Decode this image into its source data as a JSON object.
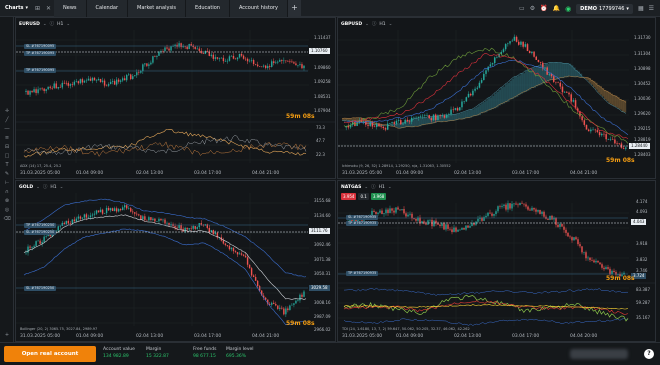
{
  "topbar": {
    "brand": "Charts",
    "tabs": [
      "News",
      "Calendar",
      "Market analysis",
      "Education",
      "Account history"
    ],
    "plus": "+",
    "account_mode": "DEMO",
    "account_id": "17799746"
  },
  "colors": {
    "up": "#26a69a",
    "down": "#ef5350",
    "accent": "#f0820a",
    "green": "#2bc46b",
    "countdown": "#f39c12"
  },
  "charts": [
    {
      "symbol": "EURUSD",
      "timeframe": "H1",
      "prices": [
        "1.11437",
        "1.10760",
        "1.09860",
        "1.09258",
        "1.08531",
        "1.07904"
      ],
      "current": "1.10760",
      "tags": [
        "SL #767190095",
        "TP #767190095",
        "TP #767190095"
      ],
      "countdown": "59m 08s",
      "ind_levels": [
        "73.3",
        "47.7",
        "22.3",
        "-3.7"
      ],
      "indicator": "ADX (14) 17, 25.4, 25.2",
      "dates": [
        "31.03.2025 05:00",
        "01.04 09:00",
        "02.04 13:00",
        "03.04 17:00",
        "04.04 21:00"
      ]
    },
    {
      "symbol": "GBPUSD",
      "timeframe": "H1",
      "prices": [
        "1.31730",
        "1.31304",
        "1.30898",
        "1.30452",
        "1.30036",
        "1.29620",
        "1.29215",
        "1.28819",
        "1.28403"
      ],
      "current": "1.28440",
      "countdown": "59m 08s",
      "indicator": "Ichimoku (9, 26, 52) 1.28914, 1.29250, n/a, 1.31063, 1.30552",
      "dates": [
        "31.03.2025 05:00",
        "01.04 09:00",
        "02.04 13:00",
        "03.04 17:00",
        "04.04 21:00"
      ]
    },
    {
      "symbol": "GOLD",
      "timeframe": "H1",
      "prices": [
        "3155.68",
        "3134.60",
        "3113.74",
        "3092.46",
        "3071.38",
        "3050.31",
        "3029.58",
        "3008.16",
        "2987.09",
        "2966.02"
      ],
      "current": "3111.76",
      "tp_price": "3029.58",
      "tags": [
        "TP #767190250",
        "SL #767190250",
        "SL #767190250"
      ],
      "countdown": "59m 08s",
      "indicator": "Bollinger (20, 2) 3065.75, 3027.84, 2989.97",
      "dates": [
        "31.03.2025 05:00",
        "01.04 09:00",
        "02.04 13:00",
        "03.04 17:00",
        "04.04 21:00"
      ]
    },
    {
      "symbol": "NATGAS",
      "timeframe": "H1",
      "trade": {
        "sell": "3.954",
        "lot": "0.1",
        "buy": "3.968"
      },
      "prices": [
        "4.174",
        "4.093",
        "3.918",
        "3.832",
        "3.746",
        "3.724"
      ],
      "current": "4.043",
      "ind_prices": [
        "83.387",
        "59.287",
        "35.167"
      ],
      "tags": [
        "SL #767190935",
        "TP #767190935",
        "TP #767190935"
      ],
      "countdown": "59m 08s",
      "indicator": "TDI (24, 1.6180, 13, 7, 2) 59.647, 50.062, 50.205, 32.37, 46.062, 42.262",
      "dates": [
        "31.03.2025 05:00",
        "01.04 09:00",
        "02.04 13:00",
        "03.04 17:00",
        "04.04 20:00"
      ]
    }
  ],
  "bottom": {
    "open_button": "Open real account",
    "account_value_label": "Account value",
    "account_value": "134 982.89",
    "margin_label": "Margin",
    "margin": "15 322.87",
    "free_funds_label": "Free funds",
    "free_funds": "98 677.15",
    "margin_level_label": "Margin level",
    "margin_level": "695.36%",
    "help": "?"
  }
}
